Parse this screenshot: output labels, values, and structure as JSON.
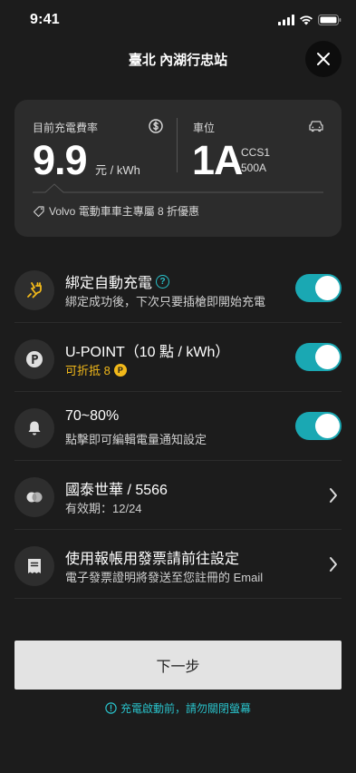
{
  "status_bar": {
    "time": "9:41"
  },
  "header": {
    "title": "臺北 內湖行忠站"
  },
  "card": {
    "rate_label": "目前充電費率",
    "rate_value": "9.9",
    "rate_unit": "元 / kWh",
    "spot_label": "車位",
    "spot_value": "1A",
    "connector_type": "CCS1",
    "connector_current": "500A",
    "promo": "Volvo 電動車車主專屬 8 折優惠"
  },
  "settings": {
    "auto_charge": {
      "title": "綁定自動充電",
      "subtitle": "綁定成功後，下次只要插槍即開始充電",
      "enabled": true
    },
    "upoint": {
      "title": "U-POINT（10 點 / kWh）",
      "subtitle": "可折抵 8",
      "badge": "P",
      "enabled": true
    },
    "notify": {
      "title": "70~80%",
      "subtitle": "點擊即可編輯電量通知設定",
      "enabled": true
    },
    "card": {
      "title": "國泰世華 / 5566",
      "subtitle": "有效期：12/24"
    },
    "invoice": {
      "title": "使用報帳用發票請前往設定",
      "subtitle": "電子發票證明將發送至您註冊的 Email"
    }
  },
  "next_label": "下一步",
  "notice": "充電啟動前，請勿關閉螢幕",
  "colors": {
    "accent": "#1aa8b3",
    "gold": "#f2b91a",
    "background": "#1c1c1c"
  },
  "icons": [
    "signal-icon",
    "wifi-icon",
    "battery-icon",
    "close-icon",
    "dollar-icon",
    "car-icon",
    "tag-icon",
    "plug-lightning-icon",
    "help-icon",
    "upoint-logo-icon",
    "bell-icon",
    "credit-card-icon",
    "receipt-icon",
    "chevron-right-icon",
    "info-icon"
  ]
}
